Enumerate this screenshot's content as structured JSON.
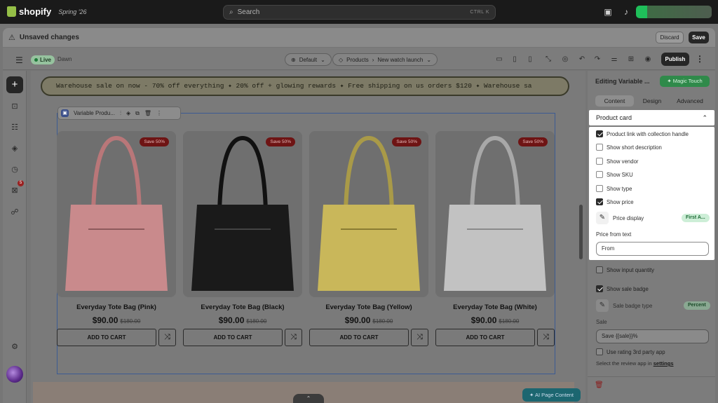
{
  "topbar": {
    "brand": "shopify",
    "season": "Spring '26",
    "search_placeholder": "Search",
    "search_shortcut": "CTRL K"
  },
  "unsaved": {
    "text": "Unsaved changes",
    "discard": "Discard",
    "save": "Save"
  },
  "editor": {
    "status": "Live",
    "theme": "Dawn",
    "template": "Default",
    "breadcrumb_a": "Products",
    "breadcrumb_b": "New watch launch",
    "publish": "Publish"
  },
  "canvas": {
    "marquee": "Warehouse sale on now - 70% off everything  ✦  20% off + glowing rewards  ✦  Free shipping on us orders $120  ✦  Warehouse sa",
    "block_label": "Variable Produ...",
    "products": [
      {
        "title": "Everyday Tote Bag (Pink)",
        "price": "$90.00",
        "compare": "$180.00",
        "badge": "Save 50%",
        "color": "#c98a8c"
      },
      {
        "title": "Everyday Tote Bag (Black)",
        "price": "$90.00",
        "compare": "$180.00",
        "badge": "Save 50%",
        "color": "#1a1a1a"
      },
      {
        "title": "Everyday Tote Bag (Yellow)",
        "price": "$90.00",
        "compare": "$180.00",
        "badge": "Save 50%",
        "color": "#c9b75a"
      },
      {
        "title": "Everyday Tote Bag (White)",
        "price": "$90.00",
        "compare": "$180.00",
        "badge": "Save 50%",
        "color": "#c2c2c2"
      }
    ],
    "add_to_cart": "ADD TO CART",
    "ai_button": "AI Page Content"
  },
  "panel": {
    "title": "Editing Variable ...",
    "magic": "Magic Touch",
    "tabs": [
      "Content",
      "Design",
      "Advanced"
    ],
    "section_title": "Product card",
    "options": [
      {
        "label": "Product link with collection handle",
        "checked": true
      },
      {
        "label": "Show short description",
        "checked": false
      },
      {
        "label": "Show vendor",
        "checked": false
      },
      {
        "label": "Show SKU",
        "checked": false
      },
      {
        "label": "Show type",
        "checked": false
      },
      {
        "label": "Show price",
        "checked": true
      }
    ],
    "price_display_label": "Price display",
    "price_display_value": "First A...",
    "price_from_label": "Price from text",
    "price_from_value": "From",
    "show_input_quantity": "Show input quantity",
    "show_sale_badge": "Show sale badge",
    "sale_badge_type_label": "Sale badge type",
    "sale_badge_type_value": "Percent",
    "sale_label": "Sale",
    "sale_value": "Save {{sale}}%",
    "use_rating": "Use rating 3rd party app",
    "review_text": "Select the review app in",
    "review_link": "settings"
  }
}
